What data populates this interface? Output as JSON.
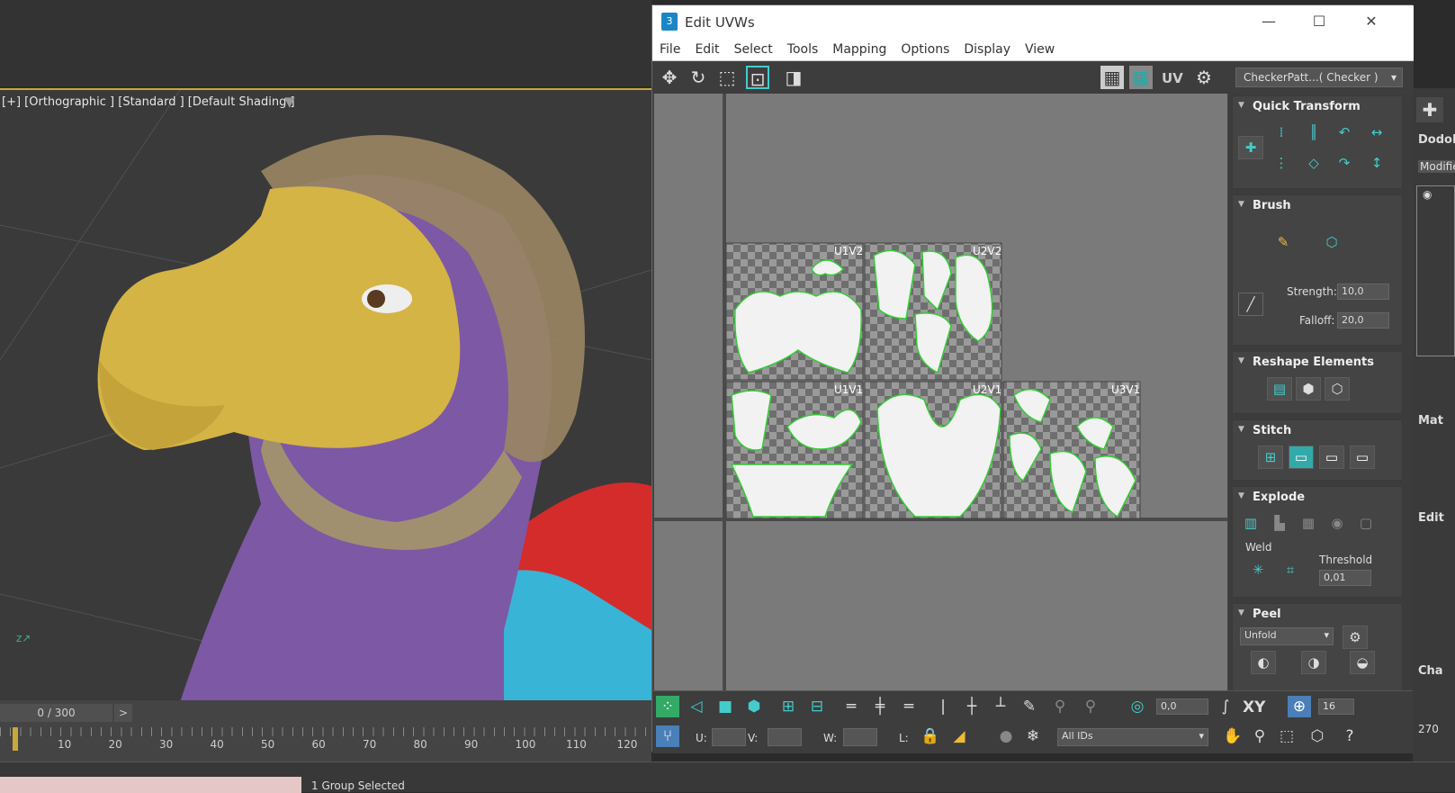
{
  "viewport": {
    "label": "[+] [Orthographic ] [Standard ] [Default Shading ]",
    "colors": {
      "beak": "#d4b445",
      "neck": "#7d58a4",
      "body_red": "#d42b2b",
      "body_cyan": "#38b4d6",
      "bg": "#3a3a3a"
    }
  },
  "timeline": {
    "frame": "0 / 300",
    "next": ">",
    "ticks": [
      "10",
      "20",
      "30",
      "40",
      "50",
      "60",
      "70",
      "80",
      "90",
      "100",
      "110",
      "120"
    ]
  },
  "status": {
    "text": "1 Group Selected"
  },
  "uv_window": {
    "title": "Edit UVWs",
    "app_icon": "3",
    "menu": [
      "File",
      "Edit",
      "Select",
      "Tools",
      "Mapping",
      "Options",
      "Display",
      "View"
    ],
    "checker": "CheckerPatt...( Checker )",
    "uv_label": "UV",
    "tiles": [
      "U1V2",
      "U2V2",
      "U1V1",
      "U2V1",
      "U3V1"
    ],
    "panels": {
      "quick_transform": "Quick Transform",
      "brush": "Brush",
      "strength_label": "Strength:",
      "strength": "10,0",
      "falloff_label": "Falloff:",
      "falloff": "20,0",
      "reshape": "Reshape Elements",
      "stitch": "Stitch",
      "explode": "Explode",
      "weld": "Weld",
      "threshold_label": "Threshold",
      "threshold": "0,01",
      "peel": "Peel",
      "unfold": "Unfold"
    },
    "bottom": {
      "angle": "0,0",
      "xy": "XY",
      "grid_count": "16",
      "u_label": "U:",
      "v_label": "V:",
      "w_label": "W:",
      "l_label": "L:",
      "ids": "All IDs"
    }
  },
  "command_panel": {
    "name": "DodoL",
    "modifier": "Modifie",
    "mat": "Mat",
    "edit": "Edit",
    "cha": "Cha",
    "right_num": "270"
  }
}
